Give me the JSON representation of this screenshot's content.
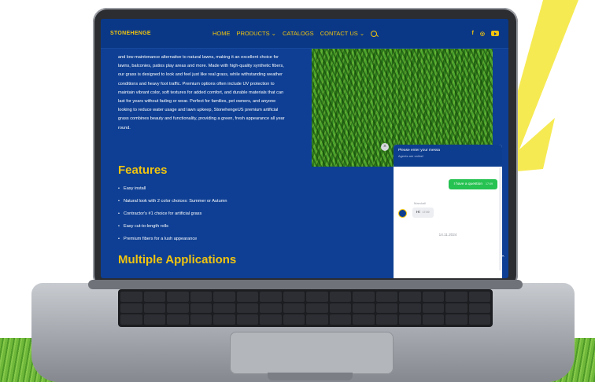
{
  "site": {
    "logo_text": "STONEHENGE",
    "menu": [
      {
        "label": "HOME"
      },
      {
        "label": "PRODUCTS ⌄"
      },
      {
        "label": "CATALOGS"
      },
      {
        "label": "CONTACT US ⌄"
      }
    ],
    "social": [
      "f",
      "◎"
    ]
  },
  "content": {
    "paragraph": "and low-maintenance alternative to natural lawns, making it an excellent choice for lawns, balconies, patios play areas and more. Made with high-quality synthetic fibers, our grass is designed to look and feel just like real grass, while withstanding weather conditions and heavy foot traffic. Premium options often include UV protection to maintain vibrant color, soft textures for added comfort, and durable materials that can last for years without fading or wear. Perfect for families, pet owners, and anyone looking to reduce water usage and lawn upkeep, StonehengeUS premium artificial grass combines beauty and functionality, providing a green, fresh appearance all year round.",
    "features_title": "Features",
    "features": [
      "Easy install",
      "Natural look with 2 color choices: Summer or Autumn",
      "Contractor's #1 choice for artificial grass",
      "Easy cut-to-length rolls",
      "Premium fibers for a lush appearance"
    ],
    "applications_title": "Multiple Applications"
  },
  "chat": {
    "title": "Please enter your messa",
    "subtitle": "Agents are online!",
    "outgoing": {
      "text": "I have a question",
      "time": "17:09"
    },
    "agent_name": "Marshall",
    "incoming": {
      "text": "Hi",
      "time": "17:09"
    },
    "date": "14.11.2024",
    "close_glyph": "×"
  },
  "colors": {
    "brand_blue": "#0e3f94",
    "accent_yellow": "#f1c40f",
    "chat_green": "#26c252"
  }
}
